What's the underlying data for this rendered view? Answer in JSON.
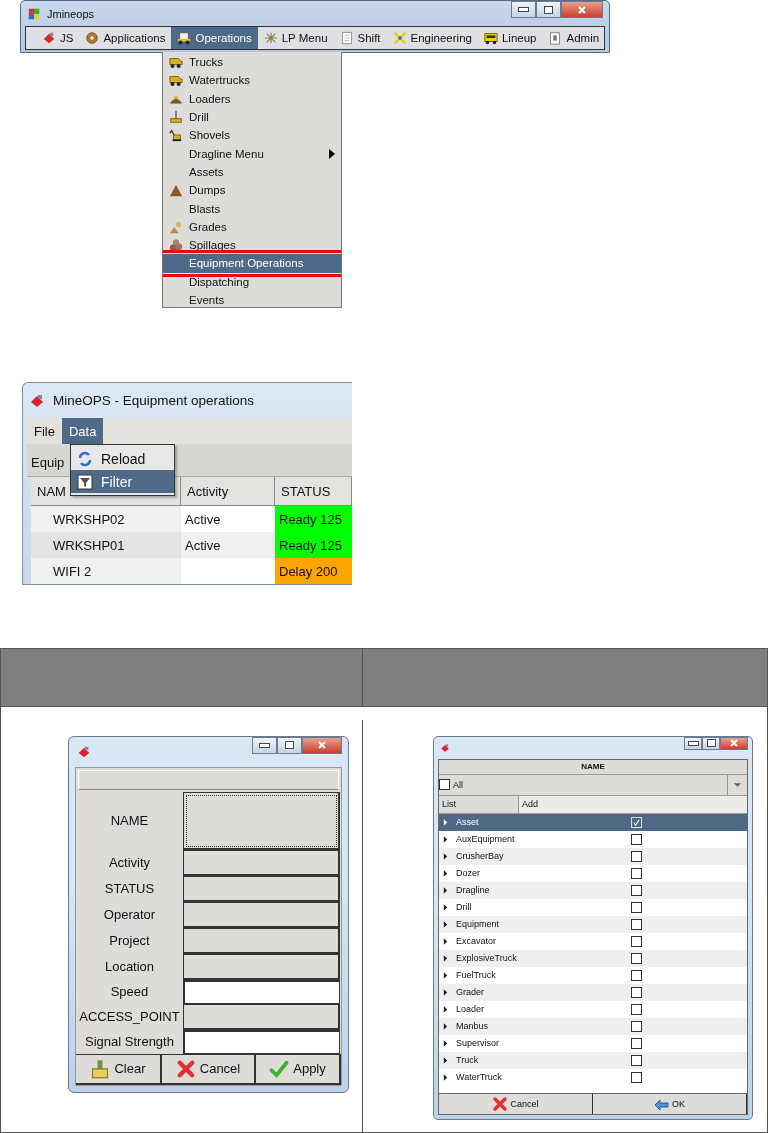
{
  "main_window": {
    "title": "Jmineops",
    "menu": [
      {
        "label": "JS",
        "selected": false
      },
      {
        "label": "Applications",
        "selected": false
      },
      {
        "label": "Operations",
        "selected": true
      },
      {
        "label": "LP Menu",
        "selected": false
      },
      {
        "label": "Shift",
        "selected": false
      },
      {
        "label": "Engineering",
        "selected": false
      },
      {
        "label": "Lineup",
        "selected": false
      },
      {
        "label": "Admin",
        "selected": false
      }
    ],
    "dropdown": [
      {
        "label": "Trucks",
        "submenu": false,
        "selected": false,
        "highlighted": false
      },
      {
        "label": "Watertrucks",
        "submenu": false,
        "selected": false,
        "highlighted": false
      },
      {
        "label": "Loaders",
        "submenu": false,
        "selected": false,
        "highlighted": false
      },
      {
        "label": "Drill",
        "submenu": false,
        "selected": false,
        "highlighted": false
      },
      {
        "label": "Shovels",
        "submenu": false,
        "selected": false,
        "highlighted": false
      },
      {
        "label": "Dragline Menu",
        "submenu": true,
        "selected": false,
        "highlighted": false
      },
      {
        "label": "Assets",
        "submenu": false,
        "selected": false,
        "highlighted": false
      },
      {
        "label": "Dumps",
        "submenu": false,
        "selected": false,
        "highlighted": false
      },
      {
        "label": "Blasts",
        "submenu": false,
        "selected": false,
        "highlighted": false
      },
      {
        "label": "Grades",
        "submenu": false,
        "selected": false,
        "highlighted": false
      },
      {
        "label": "Spillages",
        "submenu": false,
        "selected": false,
        "highlighted": false
      },
      {
        "label": "Equipment Operations",
        "submenu": false,
        "selected": true,
        "highlighted": true
      },
      {
        "label": "Dispatching",
        "submenu": false,
        "selected": false,
        "highlighted": false
      },
      {
        "label": "Events",
        "submenu": false,
        "selected": false,
        "highlighted": false
      }
    ]
  },
  "equipment_window": {
    "title": "MineOPS - Equipment operations",
    "menu": [
      {
        "label": "File",
        "selected": false
      },
      {
        "label": "Data",
        "selected": true
      }
    ],
    "tab": "Equip",
    "dropdown": [
      {
        "label": "Reload",
        "selected": false
      },
      {
        "label": "Filter",
        "selected": true
      }
    ],
    "columns": [
      "NAM",
      "Activity",
      "STATUS"
    ],
    "rows": [
      {
        "name": "WRKSHP02",
        "activity": "Active",
        "status": "Ready 125",
        "color": "#00ff00"
      },
      {
        "name": "WRKSHP01",
        "activity": "Active",
        "status": "Ready 125",
        "color": "#00ff00"
      },
      {
        "name": "WIFI 2",
        "status": "Delay 200",
        "color": "#ffa500"
      }
    ]
  },
  "filter_dialog": {
    "fields": [
      {
        "label": "NAME",
        "kind": "list"
      },
      {
        "label": "Activity",
        "kind": "combo"
      },
      {
        "label": "STATUS",
        "kind": "combo"
      },
      {
        "label": "Operator",
        "kind": "combo"
      },
      {
        "label": "Project",
        "kind": "combo"
      },
      {
        "label": "Location",
        "kind": "combo"
      },
      {
        "label": "Speed",
        "kind": "text"
      },
      {
        "label": "ACCESS_POINT",
        "kind": "combo"
      },
      {
        "label": "Signal Strength",
        "kind": "text"
      }
    ],
    "buttons": [
      "Clear",
      "Cancel",
      "Apply"
    ]
  },
  "list_dialog": {
    "header": "NAME",
    "all": {
      "label": "All",
      "checked": false
    },
    "columns": [
      "List",
      "Add"
    ],
    "items": [
      {
        "label": "Asset",
        "checked": true,
        "selected": true
      },
      {
        "label": "AuxEquipment",
        "checked": false,
        "selected": false
      },
      {
        "label": "CrusherBay",
        "checked": false,
        "selected": false
      },
      {
        "label": "Dozer",
        "checked": false,
        "selected": false
      },
      {
        "label": "Dragline",
        "checked": false,
        "selected": false
      },
      {
        "label": "Drill",
        "checked": false,
        "selected": false
      },
      {
        "label": "Equipment",
        "checked": false,
        "selected": false
      },
      {
        "label": "Excavator",
        "checked": false,
        "selected": false
      },
      {
        "label": "ExplosiveTruck",
        "checked": false,
        "selected": false
      },
      {
        "label": "FuelTruck",
        "checked": false,
        "selected": false
      },
      {
        "label": "Grader",
        "checked": false,
        "selected": false
      },
      {
        "label": "Loader",
        "checked": false,
        "selected": false
      },
      {
        "label": "Manbus",
        "checked": false,
        "selected": false
      },
      {
        "label": "Supervisor",
        "checked": false,
        "selected": false
      },
      {
        "label": "Truck",
        "checked": false,
        "selected": false
      },
      {
        "label": "WaterTruck",
        "checked": false,
        "selected": false
      }
    ],
    "buttons": [
      "Cancel",
      "OK"
    ]
  }
}
